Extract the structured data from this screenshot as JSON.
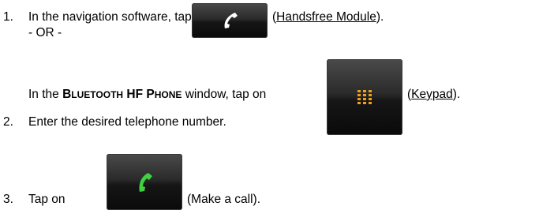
{
  "steps": [
    {
      "number": "1.",
      "line_a_prefix": "In the navigation software, tap on",
      "line_a_link": "Handsfree Module",
      "or_text": "- OR -",
      "line_b_prefix": "In the",
      "window_name_parts": [
        {
          "cap": "B",
          "rest": "LUETOOTH"
        },
        {
          "cap": "HF",
          "rest": ""
        },
        {
          "cap": "P",
          "rest": "HONE"
        }
      ],
      "line_b_middle": "window, tap on",
      "line_b_link": "Keypad"
    },
    {
      "number": "2.",
      "text": "Enter the desired telephone number."
    },
    {
      "number": "3.",
      "prefix": "Tap on",
      "suffix": "(Make a call)."
    }
  ],
  "icons": {
    "handsfree": "phone-handset-icon",
    "keypad": "keypad-icon",
    "call": "call-icon"
  },
  "colors": {
    "handset_white": "#ffffff",
    "keypad_orange": "#f0a020",
    "call_green": "#3fd13f"
  }
}
